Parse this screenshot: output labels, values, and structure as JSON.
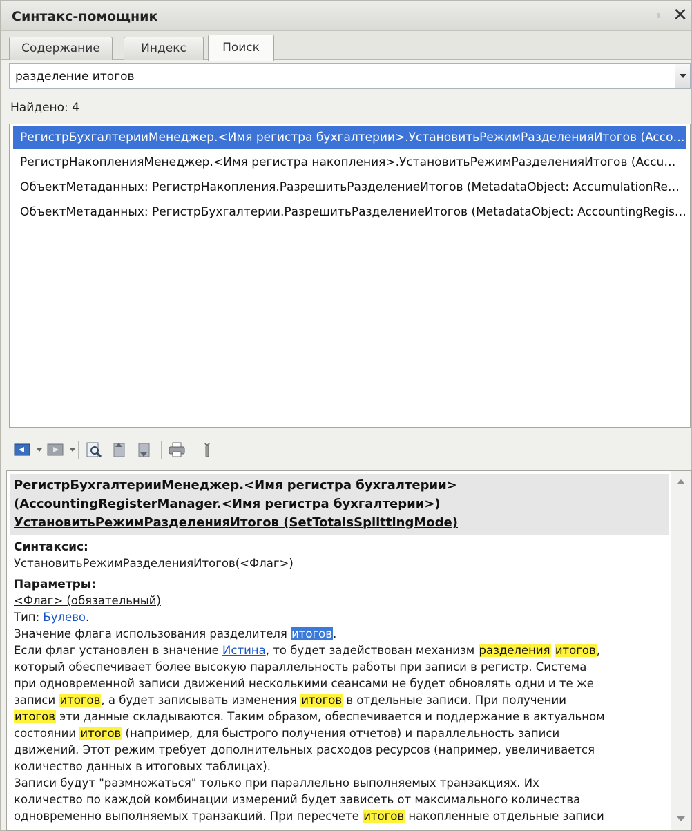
{
  "window": {
    "title": "Синтакс-помощник",
    "close_glyph": "✕"
  },
  "tabs": [
    {
      "label": "Содержание"
    },
    {
      "label": "Индекс"
    },
    {
      "label": "Поиск"
    }
  ],
  "search": {
    "value": "разделение итогов"
  },
  "found": "Найдено: 4",
  "results": [
    "РегистрБухгалтерииМенеджер.<Имя регистра бухгалтерии>.УстановитьРежимРазделенияИтогов (AccountingRegisterManager.<Имя регистра бухгалтерии>.SetTotalsSplittingMode)",
    "РегистрНакопленияМенеджер.<Имя регистра накопления>.УстановитьРежимРазделенияИтогов (AccumulationRegisterManager.<Имя регистра накопления>.SetTotalsSplittingMode)",
    "ОбъектМетаданных: РегистрНакопления.РазрешитьРазделениеИтогов (MetadataObject: AccumulationRegister.EnableTotalsSplitting)",
    "ОбъектМетаданных: РегистрБухгалтерии.РазрешитьРазделениеИтогов (MetadataObject: AccountingRegister.EnableTotalsSplitting)"
  ],
  "toolbar": [
    {
      "icon": "back-icon"
    },
    {
      "icon": "forward-icon"
    },
    {
      "icon": "find-in-tree-icon"
    },
    {
      "icon": "previous-topic-icon"
    },
    {
      "icon": "next-topic-icon"
    },
    {
      "icon": "print-icon"
    },
    {
      "icon": "settings-icon"
    }
  ],
  "content": {
    "heading_line1": "РегистрБухгалтерииМенеджер.<Имя регистра бухгалтерии>",
    "heading_line2": "(AccountingRegisterManager.<Имя регистра бухгалтерии>)",
    "heading_line3": "УстановитьРежимРазделенияИтогов (SetTotalsSplittingMode)",
    "syntax_label": "Синтаксис:",
    "syntax": "УстановитьРежимРазделенияИтогов(<Флаг>)",
    "params_label": "Параметры:",
    "param": "<Флаг> (обязательный)",
    "type_label": "Тип: ",
    "type_link": "Булево",
    "dot": ".",
    "d1a": "Значение флага использования разделителя ",
    "hl_itogov": "итогов",
    "hl_razdeleniya": "разделения",
    "d2a": "Если флаг установлен в значение ",
    "istina": "Истина",
    "d2b": ", то будет задействован механизм ",
    "space": " ",
    "d2c": ",",
    "d3": "который обеспечивает более высокую параллельность работы при записи в регистр. Система",
    "d4": "при одновременной записи движений несколькими сеансами не будет обновлять одни и те же",
    "d5a": "записи ",
    "d5b": ", а будет записывать изменения ",
    "d5c": " в отдельные записи. При получении",
    "d6b": " эти данные складываются. Таким образом, обеспечивается и поддержание в актуальном",
    "d7a": "состоянии ",
    "d7b": " (например, для быстрого получения отчетов) и параллельность записи",
    "d8": "движений. Этот режим требует дополнительных расходов ресурсов (например, увеличивается",
    "d9": "количество данных в итоговых таблицах).",
    "d10": "Записи будут \"размножаться\" только при параллельно выполняемых транзакциях. Их",
    "d11": "количество по каждой комбинации измерений будет зависеть от максимального количества",
    "d12a": "одновременно выполняемых транзакций. При пересчете ",
    "d12b": " накопленные отдельные записи"
  }
}
